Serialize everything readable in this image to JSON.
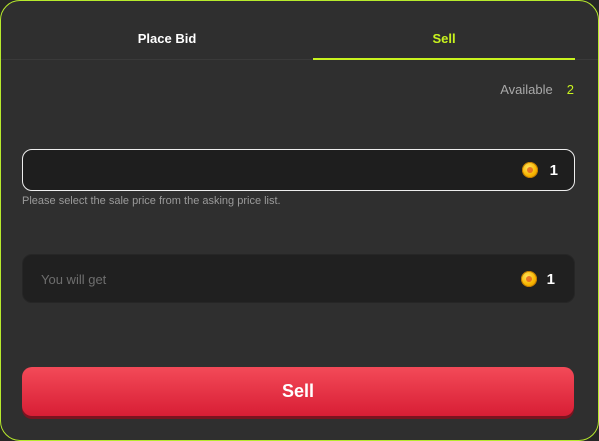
{
  "tabs": [
    {
      "label": "Place Bid",
      "active": false
    },
    {
      "label": "Sell",
      "active": true
    }
  ],
  "available": {
    "label": "Available",
    "count": "2"
  },
  "price_field": {
    "value": "",
    "placeholder": "",
    "icon": "coin-icon",
    "amount": "1"
  },
  "helper_text": "Please select the sale price from the asking price list.",
  "receive_field": {
    "placeholder": "You will get",
    "icon": "coin-icon",
    "amount": "1"
  },
  "sell_button": {
    "label": "Sell"
  },
  "colors": {
    "accent": "#c8f31e",
    "sell_button": "#e8283d",
    "panel_bg": "#2f2f2f",
    "field_bg": "#1e1e1e"
  }
}
